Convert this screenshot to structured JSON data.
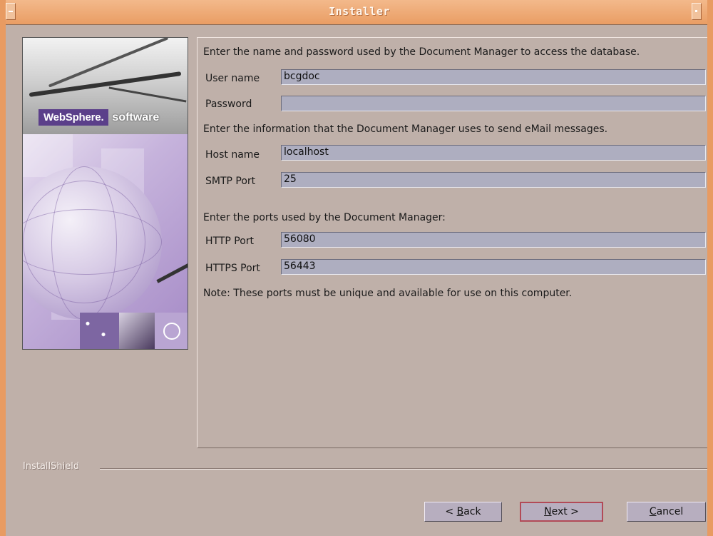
{
  "window": {
    "title": "Installer"
  },
  "intro_db": "Enter the name and password used by the Document Manager to access the database.",
  "fields_db": [
    {
      "label": "User name",
      "value": "bcgdoc"
    },
    {
      "label": "Password",
      "value": ""
    }
  ],
  "intro_mail": "Enter the information that the Document Manager uses to send eMail messages.",
  "fields_mail": [
    {
      "label": "Host name",
      "value": "localhost"
    },
    {
      "label": "SMTP Port",
      "value": "25"
    }
  ],
  "intro_ports": "Enter the ports used by the Document Manager:",
  "fields_ports": [
    {
      "label": "HTTP Port",
      "value": "56080"
    },
    {
      "label": "HTTPS Port",
      "value": "56443"
    }
  ],
  "note": "Note: These ports must be unique and available for use on this computer.",
  "branding": {
    "product_box": "WebSphere.",
    "product_word": "software",
    "footer": "InstallShield"
  },
  "buttons": {
    "back": {
      "prefix": "< ",
      "mnemonic": "B",
      "rest": "ack"
    },
    "next": {
      "mnemonic": "N",
      "rest": "ext >"
    },
    "cancel": {
      "mnemonic": "C",
      "rest": "ancel"
    }
  },
  "icons": [
    "window-menu-icon",
    "window-maximize-icon",
    "globe-icon"
  ],
  "colors": {
    "title_bar": "#e99d64",
    "background": "#bfb0a9",
    "field": "#aeaec0",
    "default_button_border": "#b24a57"
  }
}
